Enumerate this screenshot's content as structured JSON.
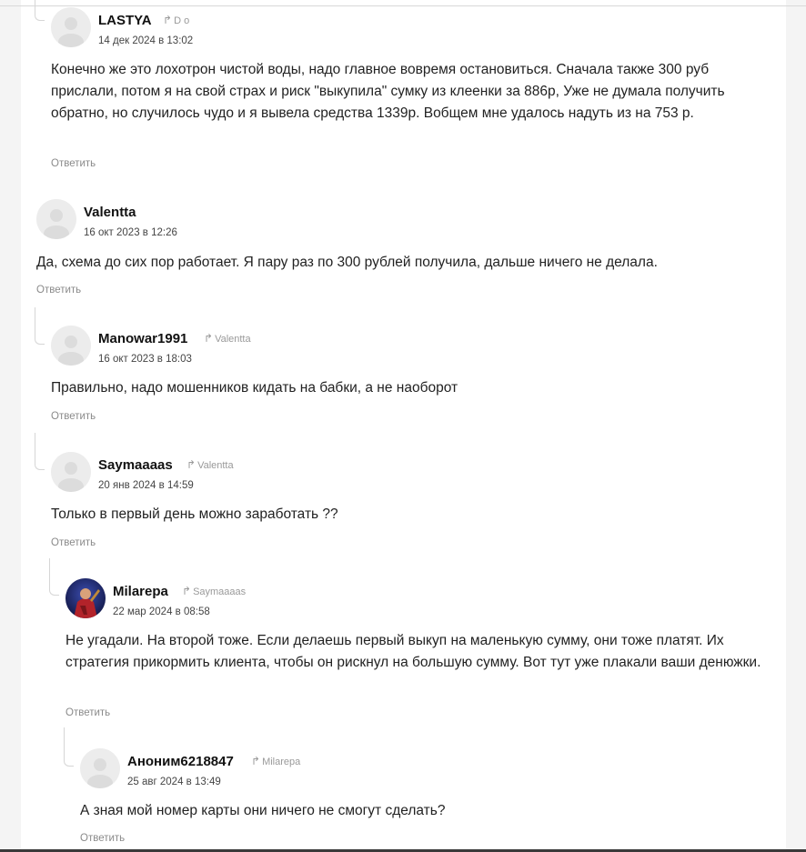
{
  "comments": [
    {
      "author": "LASTYA",
      "reply_to": "D o",
      "date": "14 дек 2024 в 13:02",
      "text": "Конечно же это лохотрон чистой воды, надо главное вовремя остановиться. Сначала также 300 руб прислали, потом  я на свой страх и риск  \"выкупила\" сумку из клеенки за 886р, Уже не думала получить обратно, но случилось чудо и я вывела средства 1339р. Вобщем мне удалось надуть из на 753 р.",
      "reply_label": "Ответить"
    },
    {
      "author": "Valentta",
      "reply_to": "",
      "date": "16 окт 2023 в 12:26",
      "text": "Да, схема до сих пор работает. Я пару раз по 300 рублей получила, дальше ничего не делала.",
      "reply_label": "Ответить"
    },
    {
      "author": "Manowar1991",
      "reply_to": "Valentta",
      "date": "16 окт 2023 в 18:03",
      "text": "Правильно, надо мошенников кидать на бабки, а не наоборот",
      "reply_label": "Ответить"
    },
    {
      "author": "Saymaaaas",
      "reply_to": "Valentta",
      "date": "20 янв 2024 в 14:59",
      "text": "Только в первый день можно заработать ??",
      "reply_label": "Ответить"
    },
    {
      "author": "Milarepa",
      "reply_to": "Saymaaaas",
      "date": "22 мар 2024 в 08:58",
      "text": "Не угадали. На второй тоже. Если делаешь первый выкуп на маленькую сумму, они тоже платят. Их стратегия прикормить клиента, чтобы он рискнул на большую сумму. Вот тут уже плакали ваши денюжки.",
      "reply_label": "Ответить"
    },
    {
      "author": "Аноним6218847",
      "reply_to": "Milarepa",
      "date": "25 авг 2024 в 13:49",
      "text": "А зная мой номер карты они ничего не смогут сделать?",
      "reply_label": "Ответить"
    }
  ],
  "icons": {
    "reply_arrow": "reply-arrow-icon",
    "avatar_placeholder": "user-placeholder-icon"
  },
  "colors": {
    "panel_bg": "#ffffff",
    "page_bg": "#f4f4f4",
    "muted_text": "#8a8a8a"
  }
}
